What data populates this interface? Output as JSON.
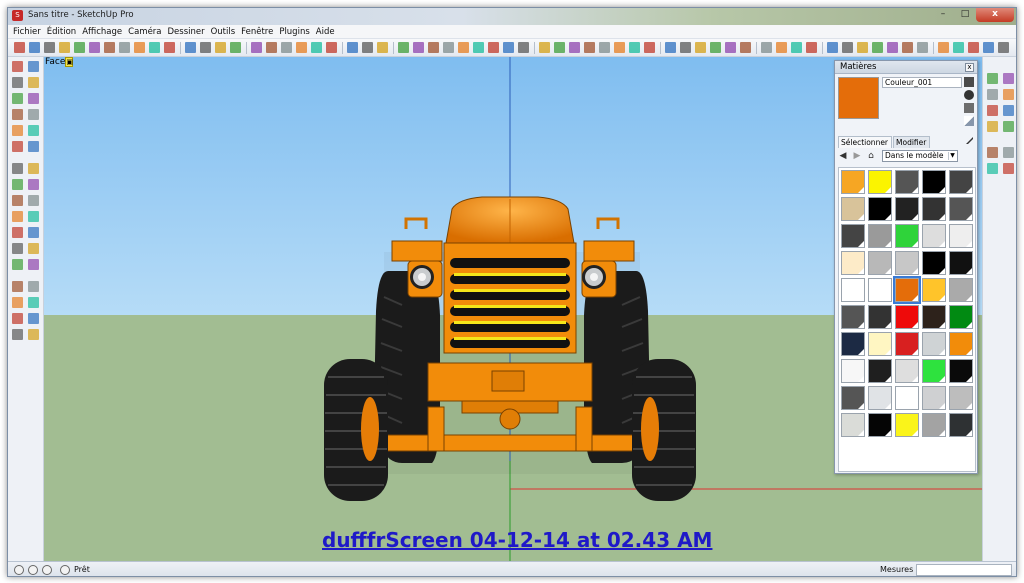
{
  "window": {
    "title": "Sans titre - SketchUp Pro",
    "controls": {
      "minimize": "–",
      "maximize": "□",
      "close": "x"
    }
  },
  "menu": [
    "Fichier",
    "Édition",
    "Affichage",
    "Caméra",
    "Dessiner",
    "Outils",
    "Fenêtre",
    "Plugins",
    "Aide"
  ],
  "viewport": {
    "face_label": "Face",
    "watermark": "dufffrScreen 04-12-14 at 02.43 AM",
    "colors": {
      "sky": "#8ec6f0",
      "ground": "#a2bd92",
      "tractor": "#f28c0a",
      "tire": "#1a1a1a"
    }
  },
  "materials_panel": {
    "title": "Matières",
    "close": "x",
    "current_name": "Couleur_001",
    "current_color": "#e46d0a",
    "tabs": [
      "Sélectionner",
      "Modifier"
    ],
    "library": "Dans le modèle",
    "nav_icons": [
      "back-arrow-icon",
      "forward-arrow-icon",
      "home-icon"
    ],
    "swatches": [
      "#f6a623",
      "#fbf400",
      "#555555",
      "#000000",
      "#444444",
      "#d8c39a",
      "#000000",
      "#222222",
      "#333333",
      "#555555",
      "#444444",
      "#9a9a9a",
      "#2fd33a",
      "#dddddd",
      "#eeeeee",
      "#fdebc8",
      "#b8b8b8",
      "#c7c7c7",
      "#000000",
      "#111111",
      "#ffffff",
      "#ffffff",
      "#e46d0a",
      "#ffc42a",
      "#aaaaaa",
      "#555555",
      "#333333",
      "#ee0a0a",
      "#2d221b",
      "#018a12",
      "#1c2a44",
      "#fff6c2",
      "#d82020",
      "#cfd3d5",
      "#f28c0a",
      "#f7f7f7",
      "#1f1f1f",
      "#dedede",
      "#2ee23e",
      "#0a0a0a",
      "#555555",
      "#e0e3e6",
      "#ffffff",
      "#cfd0d2",
      "#bdbdbd",
      "#dadcd8",
      "#050505",
      "#faf41a",
      "#a3a3a3",
      "#2e3133"
    ]
  },
  "status": {
    "ready": "Prêt",
    "measures_label": "Mesures",
    "icons": [
      "geo-location-icon",
      "credits-icon",
      "user-icon",
      "help-icon"
    ]
  }
}
